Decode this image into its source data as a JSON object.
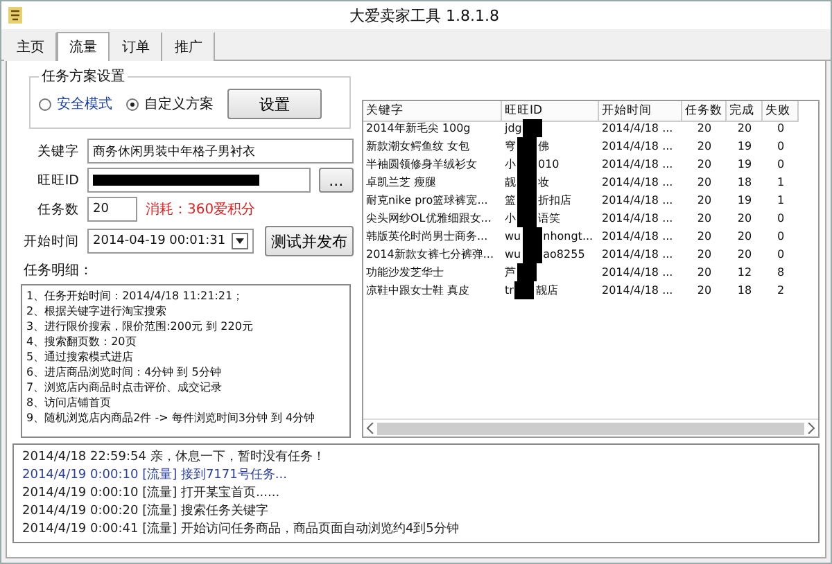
{
  "window": {
    "title": "大爱卖家工具 1.8.1.8"
  },
  "tabs": [
    {
      "label": "主页",
      "selected": false
    },
    {
      "label": "流量",
      "selected": true
    },
    {
      "label": "订单",
      "selected": false
    },
    {
      "label": "推广",
      "selected": false
    }
  ],
  "plan": {
    "legend": "任务方案设置",
    "options": [
      {
        "label": "安全模式",
        "selected": false
      },
      {
        "label": "自定义方案",
        "selected": true
      }
    ],
    "button": "设置"
  },
  "form": {
    "keyword_label": "关键字",
    "keyword": "商务休闲男装中年格子男衬衣",
    "id_label": "旺旺ID",
    "browse_button": "...",
    "count_label": "任务数",
    "count": "20",
    "cost": "消耗：360爱积分",
    "time_label": "开始时间",
    "time": "2014-04-19 00:01:31",
    "publish_button": "测试并发布"
  },
  "details": {
    "label": "任务明细：",
    "lines": [
      "1、任务开始时间：2014/4/18 11:21:21；",
      "2、根据关键字进行淘宝搜索",
      "3、进行限价搜索，限价范围:200元 到 220元",
      "4、搜索翻页数：20页",
      "5、通过搜索模式进店",
      "6、进店商品浏览时间：4分钟 到 5分钟",
      "7、浏览店内商品时点击评价、成交记录",
      "8、访问店铺首页",
      "9、随机浏览店内商品2件 -> 每件浏览时间3分钟 到 4分钟"
    ]
  },
  "table": {
    "columns": [
      "关键字",
      "旺旺ID",
      "开始时间",
      "任务数",
      "完成",
      "失败"
    ],
    "rows": [
      {
        "keyword": " 2014年新毛尖 100g",
        "id_start": "jdg",
        "id_end": "",
        "time": "2014/4/18 ...",
        "count": "20",
        "done": "20",
        "failed": "0"
      },
      {
        "keyword": "新款潮女鳄鱼纹 女包",
        "id_start": "穹",
        "id_end": "佛",
        "time": "2014/4/18 ...",
        "count": "20",
        "done": "19",
        "failed": "0"
      },
      {
        "keyword": "半袖圆领修身羊绒衫女",
        "id_start": "小",
        "id_end": "010",
        "time": "2014/4/18 ...",
        "count": "20",
        "done": "19",
        "failed": "0"
      },
      {
        "keyword": "卓凯兰芝 瘦腿",
        "id_start": "靓",
        "id_end": "妆",
        "time": "2014/4/18 ...",
        "count": "20",
        "done": "18",
        "failed": "1"
      },
      {
        "keyword": "耐克nike pro篮球裤宽...",
        "id_start": "篮",
        "id_end": "折扣店",
        "time": "2014/4/18 ...",
        "count": "20",
        "done": "19",
        "failed": "1"
      },
      {
        "keyword": "尖头网纱OL优雅细跟女...",
        "id_start": "小",
        "id_end": "语笑",
        "time": "2014/4/18 ...",
        "count": "20",
        "done": "20",
        "failed": "0"
      },
      {
        "keyword": "韩版英伦时尚男士商务...",
        "id_start": "wu",
        "id_end": "nhongt...",
        "time": "2014/4/18 ...",
        "count": "20",
        "done": "20",
        "failed": "0"
      },
      {
        "keyword": "2014新款女裤七分裤弹...",
        "id_start": "wu",
        "id_end": "ao8255",
        "time": "2014/4/18 ...",
        "count": "20",
        "done": "20",
        "failed": "0"
      },
      {
        "keyword": "功能沙发芝华士",
        "id_start": "芦",
        "id_end": "",
        "time": "2014/4/18 ...",
        "count": "20",
        "done": "12",
        "failed": "8"
      },
      {
        "keyword": "凉鞋中跟女士鞋 真皮",
        "id_start": "tr",
        "id_end": "靓店",
        "time": "2014/4/18 ...",
        "count": "20",
        "done": "18",
        "failed": "2"
      }
    ]
  },
  "log": [
    {
      "text": "2014/4/18 22:59:54 亲，休息一下，暂时没有任务！",
      "kind": "normal"
    },
    {
      "text": "2014/4/19 0:00:10 [流量] 接到7171号任务...",
      "kind": "highlight"
    },
    {
      "text": "2014/4/19 0:00:10 [流量] 打开某宝首页......",
      "kind": "normal"
    },
    {
      "text": "2014/4/19 0:00:20 [流量] 搜索任务关键字",
      "kind": "normal"
    },
    {
      "text": "2014/4/19 0:00:41 [流量] 开始访问任务商品，商品页面自动浏览约4到5分钟",
      "kind": "normal"
    }
  ]
}
